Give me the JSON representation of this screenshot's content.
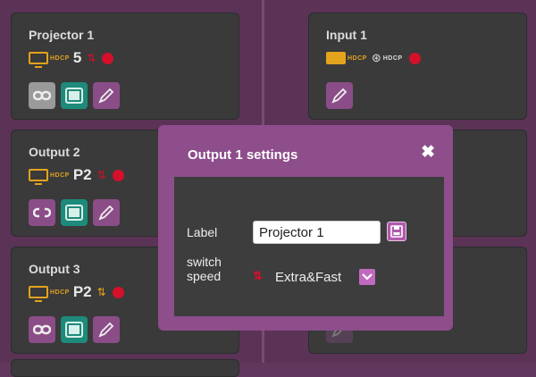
{
  "cards": {
    "projector1": {
      "title": "Projector 1",
      "hdcp": "HDCP",
      "value": "5"
    },
    "output2": {
      "title": "Output 2",
      "hdcp": "HDCP",
      "value": "P2"
    },
    "output3": {
      "title": "Output 3",
      "hdcp": "HDCP",
      "value": "P2"
    },
    "input1": {
      "title": "Input 1",
      "hdcp": "HDCP",
      "hdcp_secondary": "HDCP"
    }
  },
  "modal": {
    "title": "Output 1 settings",
    "close_glyph": "✖",
    "label_text": "Label",
    "label_value": "Projector 1",
    "switch_line1": "switch",
    "switch_line2": "speed",
    "speed_value": "Extra&Fast"
  },
  "icons": {
    "status_dot": "red-status-dot",
    "display": "display-icon",
    "arrows": "switch-arrows-icon",
    "link": "link-icon",
    "unlink": "unlink-icon",
    "film": "film-icon",
    "edit": "pencil-icon",
    "save": "save-icon",
    "dropdown": "chevron-down-icon"
  },
  "colors": {
    "background": "#5a3357",
    "card": "#3a3a3a",
    "modal_header": "#8e4d8b",
    "accent_orange": "#e3a31c",
    "accent_red": "#d4102a",
    "teal": "#1d8a7b",
    "purple_button": "#8b4d88"
  }
}
